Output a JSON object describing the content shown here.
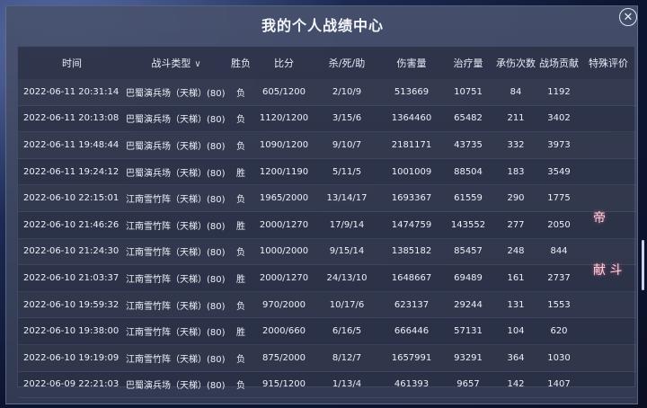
{
  "window": {
    "title": "我的个人战绩中心"
  },
  "table": {
    "headers": [
      "时间",
      "战斗类型",
      "胜负",
      "比分",
      "杀/死/助",
      "伤害量",
      "治疗量",
      "承伤次数",
      "战场贡献",
      "特殊评价"
    ],
    "rows": [
      {
        "time": "2022-06-11 20:31:14",
        "type": "巴蜀演兵场（天梯）(80)",
        "result": "负",
        "score": "605/1200",
        "kda": "2/10/9",
        "damage": "513669",
        "heal": "10751",
        "taken": "84",
        "contrib": "1192"
      },
      {
        "time": "2022-06-11 20:13:08",
        "type": "巴蜀演兵场（天梯）(80)",
        "result": "负",
        "score": "1120/1200",
        "kda": "3/15/6",
        "damage": "1364460",
        "heal": "65482",
        "taken": "211",
        "contrib": "3402"
      },
      {
        "time": "2022-06-11 19:48:44",
        "type": "巴蜀演兵场（天梯）(80)",
        "result": "负",
        "score": "1090/1200",
        "kda": "9/10/7",
        "damage": "2181171",
        "heal": "43735",
        "taken": "332",
        "contrib": "3973"
      },
      {
        "time": "2022-06-11 19:24:12",
        "type": "巴蜀演兵场（天梯）(80)",
        "result": "胜",
        "score": "1200/1190",
        "kda": "5/11/5",
        "damage": "1001009",
        "heal": "88504",
        "taken": "183",
        "contrib": "3549"
      },
      {
        "time": "2022-06-10 22:15:01",
        "type": "江南雪竹阵（天梯）(80)",
        "result": "负",
        "score": "1965/2000",
        "kda": "13/14/17",
        "damage": "1693367",
        "heal": "61559",
        "taken": "290",
        "contrib": "1775"
      },
      {
        "time": "2022-06-10 21:46:26",
        "type": "江南雪竹阵（天梯）(80)",
        "result": "胜",
        "score": "2000/1270",
        "kda": "17/9/14",
        "damage": "1474759",
        "heal": "143552",
        "taken": "277",
        "contrib": "2050"
      },
      {
        "time": "2022-06-10 21:24:30",
        "type": "江南雪竹阵（天梯）(80)",
        "result": "负",
        "score": "1000/2000",
        "kda": "9/15/14",
        "damage": "1385182",
        "heal": "85457",
        "taken": "248",
        "contrib": "844"
      },
      {
        "time": "2022-06-10 21:03:37",
        "type": "江南雪竹阵（天梯）(80)",
        "result": "胜",
        "score": "2000/1270",
        "kda": "24/13/10",
        "damage": "1648667",
        "heal": "69489",
        "taken": "161",
        "contrib": "2737"
      },
      {
        "time": "2022-06-10 19:59:32",
        "type": "江南雪竹阵（天梯）(80)",
        "result": "负",
        "score": "970/2000",
        "kda": "10/17/6",
        "damage": "623137",
        "heal": "29244",
        "taken": "131",
        "contrib": "1553"
      },
      {
        "time": "2022-06-10 19:38:00",
        "type": "江南雪竹阵（天梯）(80)",
        "result": "胜",
        "score": "2000/660",
        "kda": "6/16/5",
        "damage": "666446",
        "heal": "57131",
        "taken": "104",
        "contrib": "620"
      },
      {
        "time": "2022-06-10 19:19:09",
        "type": "江南雪竹阵（天梯）(80)",
        "result": "负",
        "score": "875/2000",
        "kda": "8/12/7",
        "damage": "1657991",
        "heal": "93291",
        "taken": "364",
        "contrib": "1030"
      },
      {
        "time": "2022-06-09 22:21:03",
        "type": "巴蜀演兵场（天梯）(80)",
        "result": "负",
        "score": "915/1200",
        "kda": "1/13/4",
        "damage": "461393",
        "heal": "9657",
        "taken": "142",
        "contrib": "1407"
      }
    ],
    "special_evals": [
      "帝",
      "献 斗"
    ]
  },
  "icons": {
    "close": "close-icon",
    "filter": "filter-chevron-icon"
  }
}
